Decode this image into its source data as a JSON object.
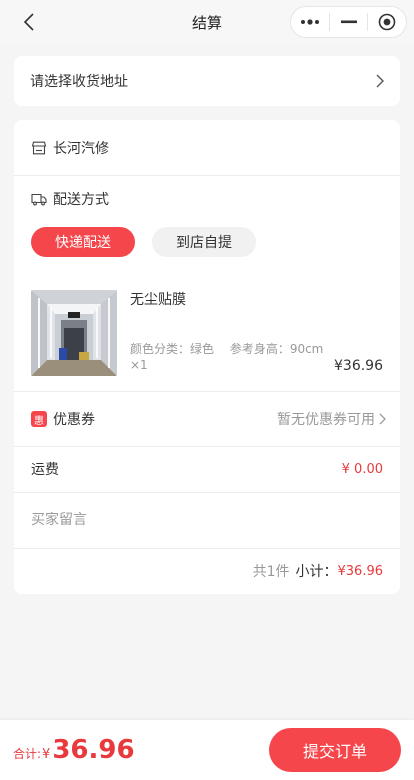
{
  "header": {
    "title": "结算",
    "back_icon": "chevron-left-icon",
    "capsule": [
      "more-dots-icon",
      "minimize-icon",
      "close-circle-icon"
    ]
  },
  "address": {
    "label": "请选择收货地址"
  },
  "shop": {
    "name": "长河汽修",
    "icon": "store-icon"
  },
  "delivery": {
    "label": "配送方式",
    "icon": "truck-icon",
    "options": [
      "快递配送",
      "到店自提"
    ],
    "selected": "快递配送"
  },
  "product": {
    "name": "无尘贴膜",
    "spec": "颜色分类：绿色　 参考身高：90cm",
    "qty": "×1",
    "price": "¥36.96"
  },
  "coupon": {
    "badge": "惠",
    "label": "优惠券",
    "status": "暂无优惠券可用"
  },
  "freight": {
    "label": "运费",
    "value": "¥ 0.00"
  },
  "note": {
    "placeholder": "买家留言",
    "value": ""
  },
  "summary": {
    "count": "共1件",
    "subtotal_label": "小计：",
    "subtotal_value": "¥36.96"
  },
  "bottom": {
    "total_label": "合计:",
    "currency": "¥",
    "total_value": "36.96",
    "submit_label": "提交订单"
  },
  "colors": {
    "accent": "#f5464c",
    "price_red": "#e8393c",
    "background": "#f5f5f5"
  }
}
